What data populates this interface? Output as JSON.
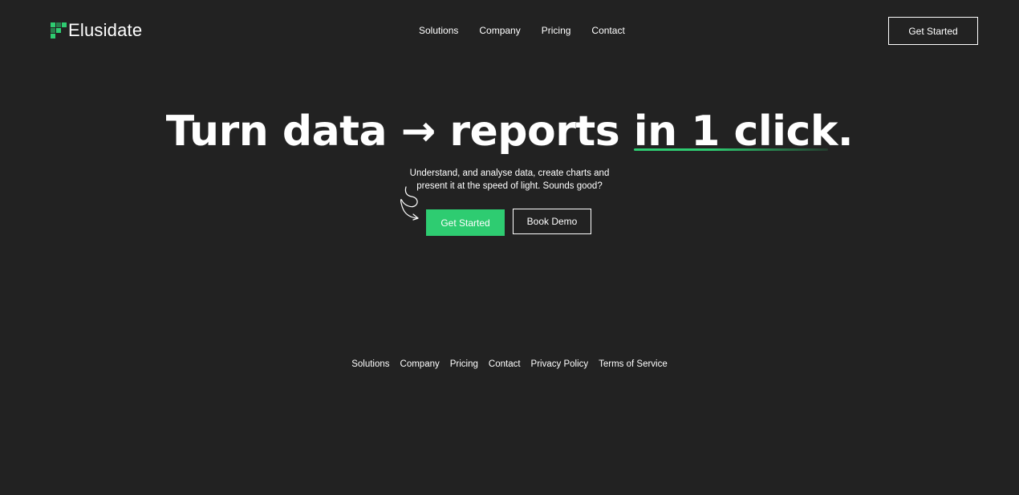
{
  "brand": {
    "name": "Elusidate",
    "accent_color": "#2ecc71",
    "background_color": "#222222"
  },
  "header": {
    "nav": [
      "Solutions",
      "Company",
      "Pricing",
      "Contact"
    ],
    "cta_label": "Get Started"
  },
  "hero": {
    "title_main": "Turn data → reports ",
    "title_accent": "in 1 click",
    "title_end": ".",
    "subtitle_line1": "Understand, and analyse data, create charts and",
    "subtitle_line2": "present it at the speed of light. Sounds good?",
    "primary_cta": "Get Started",
    "secondary_cta": "Book Demo",
    "decoration": "curly-arrow-icon"
  },
  "footer": {
    "links": [
      "Solutions",
      "Company",
      "Pricing",
      "Contact",
      "Privacy Policy",
      "Terms of Service"
    ]
  }
}
